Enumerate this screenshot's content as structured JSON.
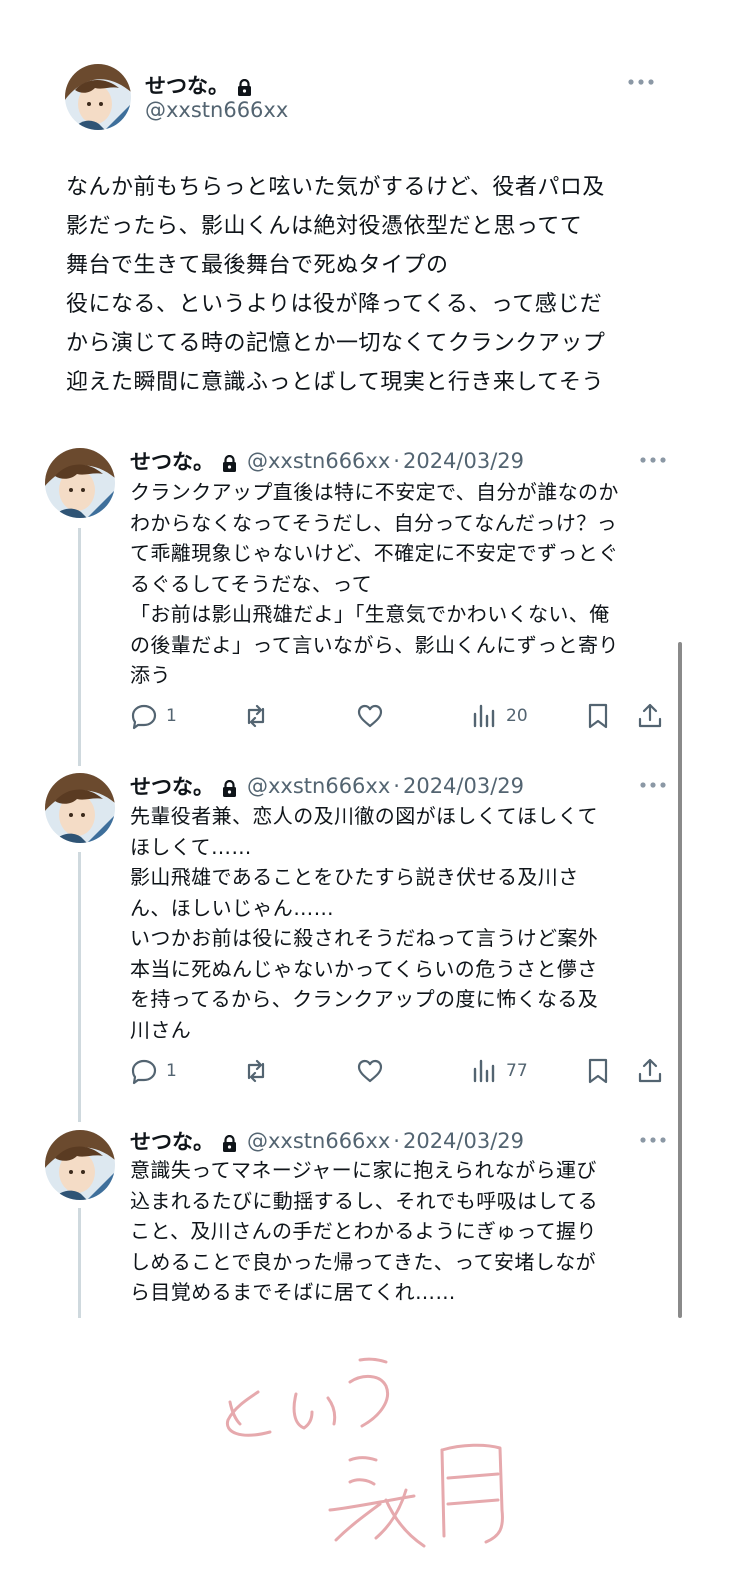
{
  "main": {
    "display_name": "せつな。",
    "handle": "@xxstn666xx",
    "text": "なんか前もちらっと呟いた気がするけど、役者パロ及\n影だったら、影山くんは絶対役憑依型だと思ってて\n舞台で生きて最後舞台で死ぬタイプの\n役になる、というよりは役が降ってくる、って感じだ\nから演じてる時の記憶とか一切なくてクランクアップ\n迎えた瞬間に意識ふっとばして現実と行き来してそう"
  },
  "replies": [
    {
      "display_name": "せつな。",
      "handle": "@xxstn666xx",
      "separator": "·",
      "date": "2024/03/29",
      "text": "クランクアップ直後は特に不安定で、自分が誰なのか\nわからなくなってそうだし、自分ってなんだっけ？っ\nて乖離現象じゃないけど、不確定に不安定でずっとぐ\nるぐるしてそうだな、って\n「お前は影山飛雄だよ」「生意気でかわいくない、俺\nの後輩だよ」って言いながら、影山くんにずっと寄り\n添う",
      "replies_count": "1",
      "views_count": "20"
    },
    {
      "display_name": "せつな。",
      "handle": "@xxstn666xx",
      "separator": "·",
      "date": "2024/03/29",
      "text": "先輩役者兼、恋人の及川徹の図がほしくてほしくて\nほしくて……\n影山飛雄であることをひたすら説き伏せる及川さ\nん、ほしいじゃん……\nいつかお前は役に殺されそうだねって言うけど案外\n本当に死ぬんじゃないかってくらいの危うさと儚さ\nを持ってるから、クランクアップの度に怖くなる及\n川さん",
      "replies_count": "1",
      "views_count": "77"
    },
    {
      "display_name": "せつな。",
      "handle": "@xxstn666xx",
      "separator": "·",
      "date": "2024/03/29",
      "text": "意識失ってマネージャーに家に抱えられながら運び\n込まれるたびに動揺するし、それでも呼吸はしてる\nこと、及川さんの手だとわかるようにぎゅって握り\nしめることで良かった帰ってきた、って安堵しなが\nら目覚めるまでそばに居てくれ……"
    }
  ],
  "handwriting": {
    "text": "という 妄想",
    "color": "#e6a9ad"
  },
  "icons": {
    "lock": "lock-icon",
    "more": "more-icon",
    "reply": "reply-icon",
    "retweet": "retweet-icon",
    "like": "like-icon",
    "views": "views-icon",
    "bookmark": "bookmark-icon",
    "share": "share-icon"
  },
  "colors": {
    "text": "#0f1419",
    "secondary": "#536471",
    "thread_line": "#cfd9de"
  }
}
